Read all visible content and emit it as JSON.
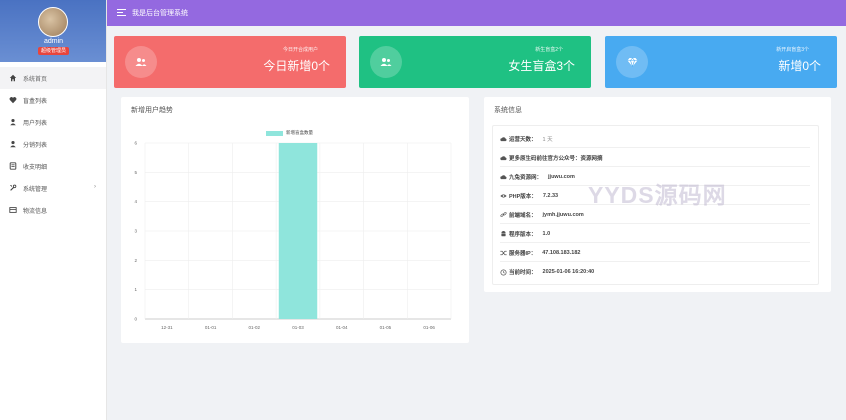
{
  "sidebar": {
    "user": {
      "name": "admin",
      "role": "超级管理员"
    },
    "items": [
      {
        "label": "系统首页",
        "icon": "home-icon",
        "active": true
      },
      {
        "label": "盲盒列表",
        "icon": "heart-icon"
      },
      {
        "label": "用户列表",
        "icon": "user-icon"
      },
      {
        "label": "分销列表",
        "icon": "user-icon"
      },
      {
        "label": "收支明细",
        "icon": "receipt-icon"
      },
      {
        "label": "系统管理",
        "icon": "settings-icon",
        "arrow": "›"
      },
      {
        "label": "物流信息",
        "icon": "truck-icon"
      }
    ]
  },
  "header": {
    "title": "我是后台管理系统"
  },
  "stats": [
    {
      "subtitle": "今日开合成用户",
      "value": "今日新增0个",
      "color": "#f46c6c",
      "icon": "users-icon"
    },
    {
      "subtitle": "新生盲盒2个",
      "value": "女生盲盒3个",
      "color": "#1fc183",
      "icon": "users-icon"
    },
    {
      "subtitle": "新开启盲盒3个",
      "value": "新增0个",
      "color": "#48aaf1",
      "icon": "diamond-icon"
    }
  ],
  "chart_panel": {
    "title": "新增用户趋势"
  },
  "chart_data": {
    "type": "bar",
    "categories": [
      "12-31",
      "01-01",
      "01-02",
      "01-03",
      "01-04",
      "01-05",
      "01-06"
    ],
    "series": [
      {
        "name": "新增盲盒数量",
        "values": [
          0,
          0,
          0,
          6,
          0,
          0,
          0
        ],
        "color": "#8fe5dc"
      }
    ],
    "ylim": [
      0,
      6
    ],
    "yticks": [
      0,
      1,
      2,
      3,
      4,
      5,
      6
    ],
    "grid": true,
    "legend": "top-center"
  },
  "sys_panel": {
    "title": "系统信息",
    "rows": [
      {
        "label": "运营天数：",
        "value": "1 天",
        "icon": "cloud-icon",
        "light": true
      },
      {
        "label": "更多原生码前往官方公众号：资源网摘",
        "value": "",
        "icon": "cloud-icon"
      },
      {
        "label": "九兔资源网：",
        "value": "jjuwu.com",
        "icon": "cloud-icon"
      },
      {
        "label": "PHP版本：",
        "value": "7.2.33",
        "icon": "eye-icon"
      },
      {
        "label": "前端域名：",
        "value": "jymh.jjuwu.com",
        "icon": "link-icon"
      },
      {
        "label": "程序版本：",
        "value": "1.0",
        "icon": "android-icon"
      },
      {
        "label": "服务器IP：",
        "value": "47.108.183.182",
        "icon": "shuffle-icon"
      },
      {
        "label": "当前时间：",
        "value": "2025-01-06 16:20:40",
        "icon": "clock-icon"
      }
    ]
  },
  "watermark": "YYDS源码网",
  "colors": {
    "header": "#9469e0",
    "sidebar_profile": "#4a72c2"
  }
}
